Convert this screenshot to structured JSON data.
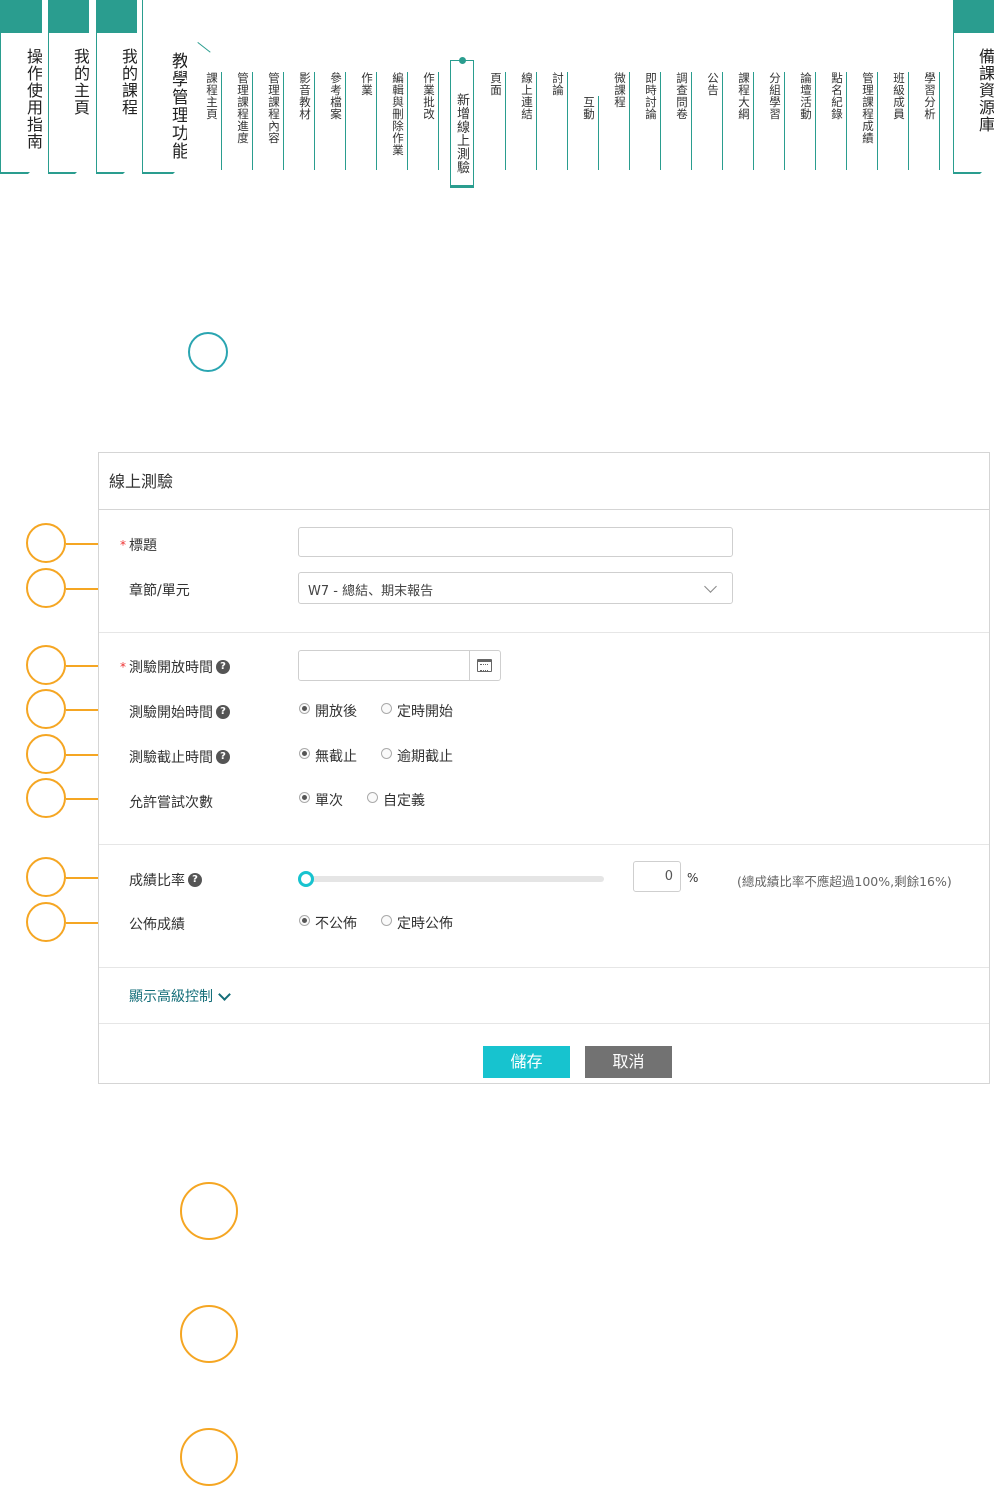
{
  "nav": {
    "big_tabs": [
      "操作使用指南",
      "我的主頁",
      "我的課程",
      "教學管理功能",
      "備課資源庫"
    ],
    "small_tabs": [
      "課程主頁",
      "管理課程進度",
      "管理課程內容",
      "影音教材",
      "參考檔案",
      "作業",
      "編輯與刪除作業",
      "作業批改",
      "新增線上測驗",
      "頁面",
      "線上連結",
      "討論",
      "互動",
      "微課程",
      "即時討論",
      "調查問卷",
      "公告",
      "課程大綱",
      "分組學習",
      "論壇活動",
      "點名紀錄",
      "管理課程成績",
      "班級成員",
      "學習分析"
    ],
    "active_tab": "新增線上測驗"
  },
  "form": {
    "title": "線上測驗",
    "fields": {
      "title_label": "標題",
      "title_value": "",
      "chapter_label": "章節/單元",
      "chapter_value": "W7 - 總結、期末報告",
      "open_time_label": "測驗開放時間",
      "open_time_value": "",
      "start_time_label": "測驗開始時間",
      "start_time_options": [
        "開放後",
        "定時開始"
      ],
      "deadline_label": "測驗截止時間",
      "deadline_options": [
        "無截止",
        "逾期截止"
      ],
      "attempts_label": "允許嘗試次數",
      "attempts_options": [
        "單次",
        "自定義"
      ],
      "grade_ratio_label": "成績比率",
      "grade_ratio_value": "0",
      "grade_ratio_unit": "%",
      "grade_ratio_hint": "(總成績比率不應超過100%,剩餘16%)",
      "publish_label": "公佈成績",
      "publish_options": [
        "不公佈",
        "定時公佈"
      ]
    },
    "advanced_link": "顯示高級控制",
    "save_label": "儲存",
    "cancel_label": "取消"
  },
  "required_mark": "*",
  "help_glyph": "?",
  "colors": {
    "accent": "#2a9d8f",
    "button_save": "#17c3cf",
    "button_cancel": "#727272",
    "marker": "#f5a623"
  }
}
